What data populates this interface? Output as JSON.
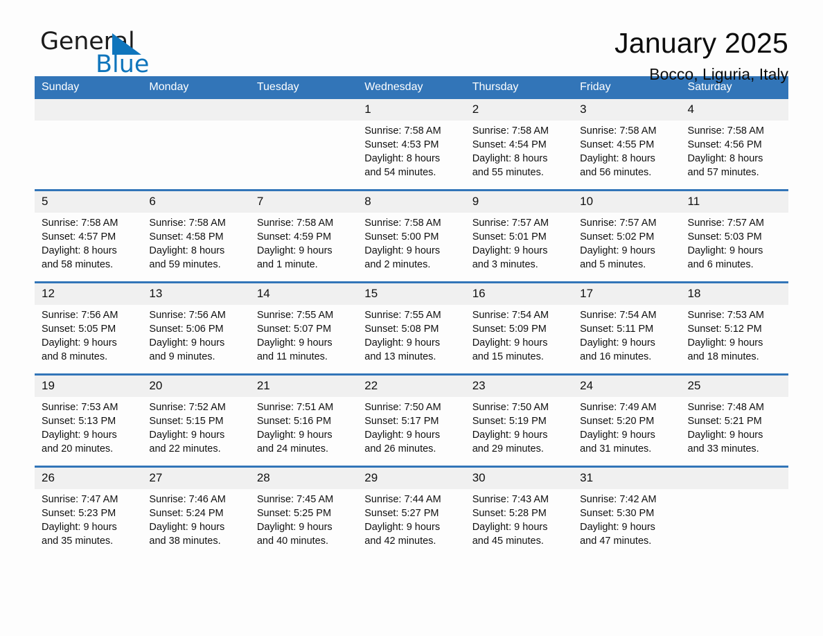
{
  "brand": {
    "name_part1": "General",
    "name_part2": "Blue",
    "triangle_color": "#0f75bc"
  },
  "header": {
    "title": "January 2025",
    "location": "Bocco, Liguria, Italy"
  },
  "theme": {
    "header_blue": "#3275b8",
    "daynum_gray": "#f0f0f0",
    "page_background": "#fdfdfd"
  },
  "weekday_headers": [
    "Sunday",
    "Monday",
    "Tuesday",
    "Wednesday",
    "Thursday",
    "Friday",
    "Saturday"
  ],
  "weeks": [
    [
      {
        "day": "",
        "lines": []
      },
      {
        "day": "",
        "lines": []
      },
      {
        "day": "",
        "lines": []
      },
      {
        "day": "1",
        "lines": [
          "Sunrise: 7:58 AM",
          "Sunset: 4:53 PM",
          "Daylight: 8 hours",
          "and 54 minutes."
        ]
      },
      {
        "day": "2",
        "lines": [
          "Sunrise: 7:58 AM",
          "Sunset: 4:54 PM",
          "Daylight: 8 hours",
          "and 55 minutes."
        ]
      },
      {
        "day": "3",
        "lines": [
          "Sunrise: 7:58 AM",
          "Sunset: 4:55 PM",
          "Daylight: 8 hours",
          "and 56 minutes."
        ]
      },
      {
        "day": "4",
        "lines": [
          "Sunrise: 7:58 AM",
          "Sunset: 4:56 PM",
          "Daylight: 8 hours",
          "and 57 minutes."
        ]
      }
    ],
    [
      {
        "day": "5",
        "lines": [
          "Sunrise: 7:58 AM",
          "Sunset: 4:57 PM",
          "Daylight: 8 hours",
          "and 58 minutes."
        ]
      },
      {
        "day": "6",
        "lines": [
          "Sunrise: 7:58 AM",
          "Sunset: 4:58 PM",
          "Daylight: 8 hours",
          "and 59 minutes."
        ]
      },
      {
        "day": "7",
        "lines": [
          "Sunrise: 7:58 AM",
          "Sunset: 4:59 PM",
          "Daylight: 9 hours",
          "and 1 minute."
        ]
      },
      {
        "day": "8",
        "lines": [
          "Sunrise: 7:58 AM",
          "Sunset: 5:00 PM",
          "Daylight: 9 hours",
          "and 2 minutes."
        ]
      },
      {
        "day": "9",
        "lines": [
          "Sunrise: 7:57 AM",
          "Sunset: 5:01 PM",
          "Daylight: 9 hours",
          "and 3 minutes."
        ]
      },
      {
        "day": "10",
        "lines": [
          "Sunrise: 7:57 AM",
          "Sunset: 5:02 PM",
          "Daylight: 9 hours",
          "and 5 minutes."
        ]
      },
      {
        "day": "11",
        "lines": [
          "Sunrise: 7:57 AM",
          "Sunset: 5:03 PM",
          "Daylight: 9 hours",
          "and 6 minutes."
        ]
      }
    ],
    [
      {
        "day": "12",
        "lines": [
          "Sunrise: 7:56 AM",
          "Sunset: 5:05 PM",
          "Daylight: 9 hours",
          "and 8 minutes."
        ]
      },
      {
        "day": "13",
        "lines": [
          "Sunrise: 7:56 AM",
          "Sunset: 5:06 PM",
          "Daylight: 9 hours",
          "and 9 minutes."
        ]
      },
      {
        "day": "14",
        "lines": [
          "Sunrise: 7:55 AM",
          "Sunset: 5:07 PM",
          "Daylight: 9 hours",
          "and 11 minutes."
        ]
      },
      {
        "day": "15",
        "lines": [
          "Sunrise: 7:55 AM",
          "Sunset: 5:08 PM",
          "Daylight: 9 hours",
          "and 13 minutes."
        ]
      },
      {
        "day": "16",
        "lines": [
          "Sunrise: 7:54 AM",
          "Sunset: 5:09 PM",
          "Daylight: 9 hours",
          "and 15 minutes."
        ]
      },
      {
        "day": "17",
        "lines": [
          "Sunrise: 7:54 AM",
          "Sunset: 5:11 PM",
          "Daylight: 9 hours",
          "and 16 minutes."
        ]
      },
      {
        "day": "18",
        "lines": [
          "Sunrise: 7:53 AM",
          "Sunset: 5:12 PM",
          "Daylight: 9 hours",
          "and 18 minutes."
        ]
      }
    ],
    [
      {
        "day": "19",
        "lines": [
          "Sunrise: 7:53 AM",
          "Sunset: 5:13 PM",
          "Daylight: 9 hours",
          "and 20 minutes."
        ]
      },
      {
        "day": "20",
        "lines": [
          "Sunrise: 7:52 AM",
          "Sunset: 5:15 PM",
          "Daylight: 9 hours",
          "and 22 minutes."
        ]
      },
      {
        "day": "21",
        "lines": [
          "Sunrise: 7:51 AM",
          "Sunset: 5:16 PM",
          "Daylight: 9 hours",
          "and 24 minutes."
        ]
      },
      {
        "day": "22",
        "lines": [
          "Sunrise: 7:50 AM",
          "Sunset: 5:17 PM",
          "Daylight: 9 hours",
          "and 26 minutes."
        ]
      },
      {
        "day": "23",
        "lines": [
          "Sunrise: 7:50 AM",
          "Sunset: 5:19 PM",
          "Daylight: 9 hours",
          "and 29 minutes."
        ]
      },
      {
        "day": "24",
        "lines": [
          "Sunrise: 7:49 AM",
          "Sunset: 5:20 PM",
          "Daylight: 9 hours",
          "and 31 minutes."
        ]
      },
      {
        "day": "25",
        "lines": [
          "Sunrise: 7:48 AM",
          "Sunset: 5:21 PM",
          "Daylight: 9 hours",
          "and 33 minutes."
        ]
      }
    ],
    [
      {
        "day": "26",
        "lines": [
          "Sunrise: 7:47 AM",
          "Sunset: 5:23 PM",
          "Daylight: 9 hours",
          "and 35 minutes."
        ]
      },
      {
        "day": "27",
        "lines": [
          "Sunrise: 7:46 AM",
          "Sunset: 5:24 PM",
          "Daylight: 9 hours",
          "and 38 minutes."
        ]
      },
      {
        "day": "28",
        "lines": [
          "Sunrise: 7:45 AM",
          "Sunset: 5:25 PM",
          "Daylight: 9 hours",
          "and 40 minutes."
        ]
      },
      {
        "day": "29",
        "lines": [
          "Sunrise: 7:44 AM",
          "Sunset: 5:27 PM",
          "Daylight: 9 hours",
          "and 42 minutes."
        ]
      },
      {
        "day": "30",
        "lines": [
          "Sunrise: 7:43 AM",
          "Sunset: 5:28 PM",
          "Daylight: 9 hours",
          "and 45 minutes."
        ]
      },
      {
        "day": "31",
        "lines": [
          "Sunrise: 7:42 AM",
          "Sunset: 5:30 PM",
          "Daylight: 9 hours",
          "and 47 minutes."
        ]
      },
      {
        "day": "",
        "lines": []
      }
    ]
  ]
}
